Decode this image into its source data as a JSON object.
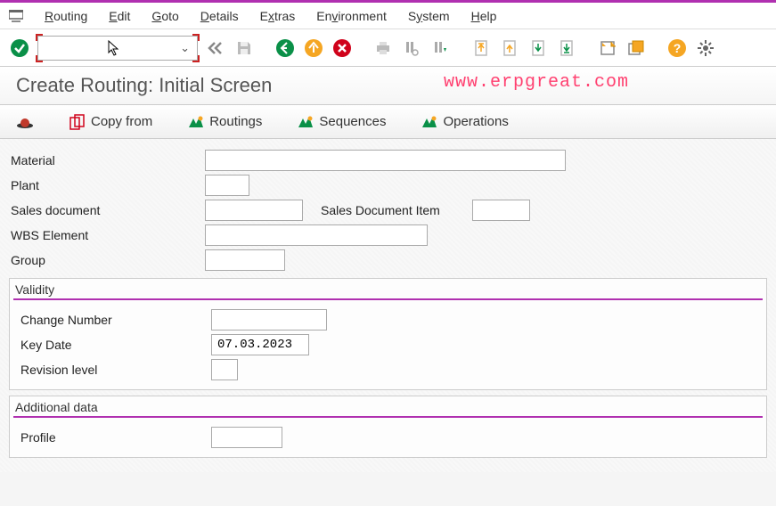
{
  "menu": {
    "items": [
      "Routing",
      "Edit",
      "Goto",
      "Details",
      "Extras",
      "Environment",
      "System",
      "Help"
    ]
  },
  "toolbar": {
    "combo_value": "",
    "combo_caret": "⌄"
  },
  "page": {
    "title": "Create Routing: Initial Screen",
    "watermark": "www.erpgreat.com"
  },
  "app_toolbar": {
    "copy_from": "Copy from",
    "routings": "Routings",
    "sequences": "Sequences",
    "operations": "Operations"
  },
  "fields": {
    "material_label": "Material",
    "material_value": "",
    "plant_label": "Plant",
    "plant_value": "",
    "sales_doc_label": "Sales document",
    "sales_doc_value": "",
    "sales_doc_item_label": "Sales Document Item",
    "sales_doc_item_value": "",
    "wbs_label": "WBS Element",
    "wbs_value": "",
    "group_label": "Group",
    "group_value": ""
  },
  "validity": {
    "legend": "Validity",
    "change_number_label": "Change Number",
    "change_number_value": "",
    "key_date_label": "Key Date",
    "key_date_value": "07.03.2023",
    "revision_label": "Revision level",
    "revision_value": ""
  },
  "additional": {
    "legend": "Additional data",
    "profile_label": "Profile",
    "profile_value": ""
  }
}
